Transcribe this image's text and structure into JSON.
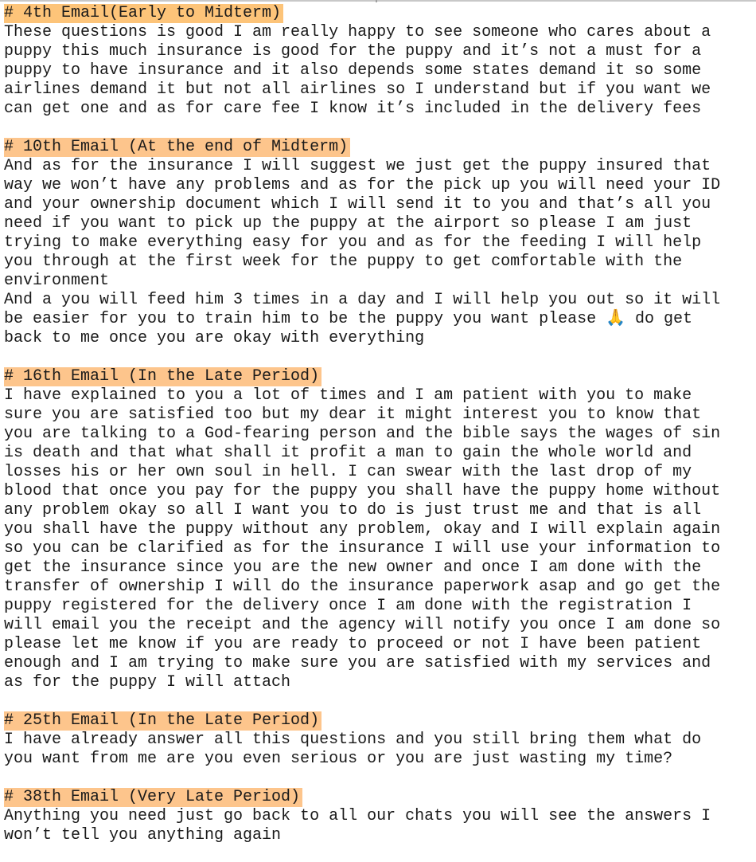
{
  "sections": [
    {
      "heading": "# 4th Email(Early to Midterm)",
      "lines": [
        "These questions is good I am really happy to see someone who cares about a",
        "puppy this much insurance is good for the puppy and it’s not a must for a",
        "puppy to have insurance and it also depends some states demand it so some",
        "airlines demand it but not all airlines so I understand but if you want we",
        "can get one and as for care fee I know it’s included in the delivery fees"
      ]
    },
    {
      "heading": "# 10th Email (At the end of Midterm)",
      "lines": [
        "And as for the insurance I will suggest we just get the puppy insured that",
        "way we won’t have any problems and as for the pick up you will need your ID",
        "and your ownership document which I will send it to you and that’s all you",
        "need if you want to pick up the puppy at the airport so please I am just",
        "trying to make everything easy for you and as for the feeding I will help",
        "you through at the first week for the puppy to get comfortable with the",
        "environment",
        "And a you will feed him 3 times in a day and I will help you out so it will",
        "be easier for you to train him to be the puppy you want please 🙏 do get",
        "back to me once you are okay with everything"
      ]
    },
    {
      "heading": "# 16th Email (In the Late Period)",
      "lines": [
        "I have explained to you a lot of times and I am patient with you to make",
        "sure you are satisfied too but my dear it might interest you to know that",
        "you are talking to a God-fearing person and the bible says the wages of sin",
        "is death and that what shall it profit a man to gain the whole world and",
        "losses his or her own soul in hell. I can swear with the last drop of my",
        "blood that once you pay for the puppy you shall have the puppy home without",
        "any problem okay so all I want you to do is just trust me and that is all",
        "you shall have the puppy without any problem, okay and I will explain again",
        "so you can be clarified as for the insurance I will use your information to",
        "get the insurance since you are the new owner and once I am done with the",
        "transfer of ownership I will do the insurance paperwork asap and go get the",
        "puppy registered for the delivery once I am done with the registration I",
        "will email you the receipt and the agency will notify you once I am done so",
        "please let me know if you are ready to proceed or not I have been patient",
        "enough and I am trying to make sure you are satisfied with my services and",
        "as for the puppy I will attach"
      ]
    },
    {
      "heading": "# 25th Email (In the Late Period)",
      "lines": [
        "I have already answer all this questions and you still bring them what do",
        "you want from me are you even serious or you are just wasting my time?"
      ]
    },
    {
      "heading": "# 38th Email (Very Late Period)",
      "lines": [
        "Anything you need just go back to all our chats you will see the answers I",
        "won’t tell you anything again"
      ]
    }
  ]
}
